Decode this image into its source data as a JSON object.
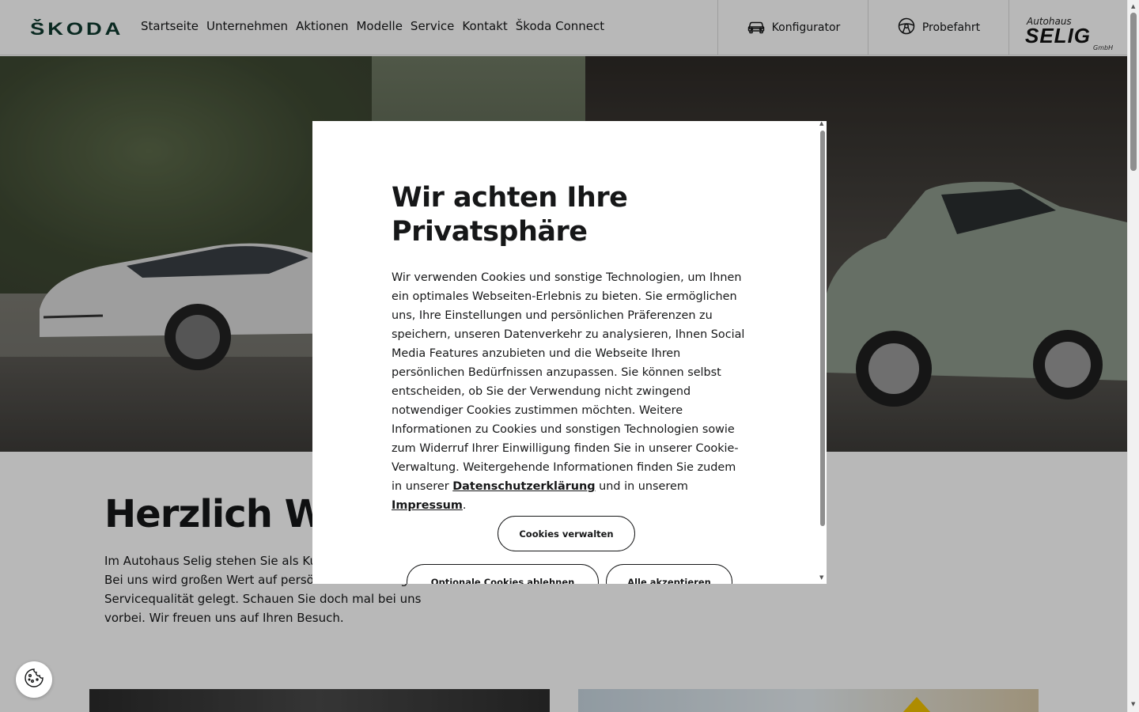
{
  "header": {
    "logo": "ŠKODA",
    "nav": [
      "Startseite",
      "Unternehmen",
      "Aktionen",
      "Modelle",
      "Service",
      "Kontakt",
      "Škoda Connect"
    ],
    "configurator_label": "Konfigurator",
    "testdrive_label": "Probefahrt",
    "dealer": {
      "line1": "Autohaus",
      "line2": "SELIG",
      "line3": "GmbH"
    }
  },
  "welcome": {
    "title": "Herzlich Willkommen",
    "text": "Im Autohaus Selig stehen Sie als Kunde im Mittelpunkt. Bei uns wird großen Wert auf persönliche Beratung und Servicequalität gelegt. Schauen Sie doch mal bei uns vorbei. Wir freuen uns auf Ihren Besuch."
  },
  "cookie_modal": {
    "title": "Wir achten Ihre Privatsphäre",
    "text_before": "Wir verwenden Cookies und sonstige Technologien, um Ihnen ein optimales Webseiten-Erlebnis zu bieten. Sie ermöglichen uns, Ihre Einstellungen und persönlichen Präferenzen zu speichern, unseren Datenverkehr zu analysieren, Ihnen Social Media Features anzubieten und die Webseite Ihren persönlichen Bedürfnissen anzupassen. Sie können selbst entscheiden, ob Sie der Verwendung nicht zwingend notwendiger Cookies zustimmen möchten. Weitere Informationen zu Cookies und sonstigen Technologien sowie zum Widerruf Ihrer Einwilligung finden Sie in unserer Cookie-Verwaltung. Weitergehende Informationen finden Sie zudem in unserer ",
    "privacy_link": "Datenschutzerklärung",
    "text_middle": " und in unserem ",
    "imprint_link": "Impressum",
    "text_after": ".",
    "manage_label": "Cookies verwalten",
    "reject_label": "Optionale Cookies ablehnen",
    "accept_label": "Alle akzeptieren"
  },
  "icons": {
    "configurator": "car-icon",
    "testdrive": "steering-wheel-icon",
    "cookie_settings": "cookie-icon"
  },
  "colors": {
    "brand_green": "#0e3a2f",
    "text": "#161718",
    "overlay": "rgba(0,0,0,0.28)"
  }
}
